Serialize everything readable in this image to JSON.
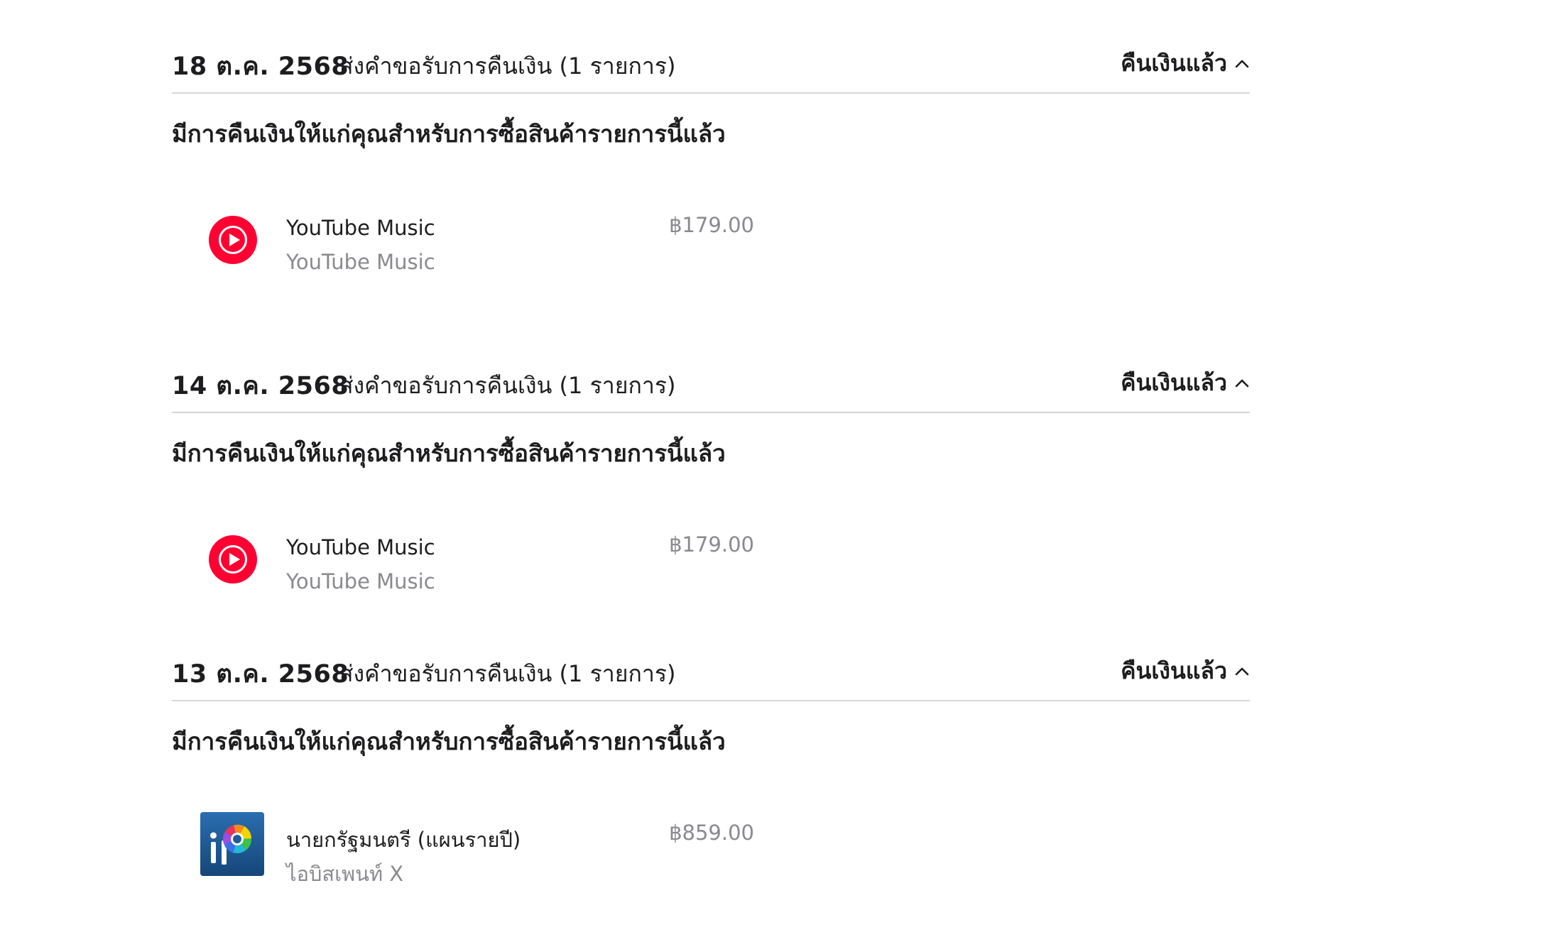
{
  "colors": {
    "accent_red": "#ff0033",
    "text_primary": "#1d1d1f",
    "text_secondary": "#8a8a8e",
    "divider": "#d6d6d6",
    "ibis_bg": "#1f5c99"
  },
  "sections": [
    {
      "date": "18 ต.ค. 2568",
      "type": "ส่งคำขอรับการคืนเงิน (1 รายการ)",
      "status": "คืนเงินแล้ว",
      "status_icon": "chevron-up-icon",
      "note": "มีการคืนเงินให้แก่คุณสำหรับการซื้อสินค้ารายการนี้แล้ว",
      "item": {
        "icon": "youtube-music-icon",
        "title": "YouTube Music",
        "subtitle": "YouTube Music",
        "price": "฿179.00"
      }
    },
    {
      "date": "14 ต.ค. 2568",
      "type": "ส่งคำขอรับการคืนเงิน (1 รายการ)",
      "status": "คืนเงินแล้ว",
      "status_icon": "chevron-up-icon",
      "note": "มีการคืนเงินให้แก่คุณสำหรับการซื้อสินค้ารายการนี้แล้ว",
      "item": {
        "icon": "youtube-music-icon",
        "title": "YouTube Music",
        "subtitle": "YouTube Music",
        "price": "฿179.00"
      }
    },
    {
      "date": "13 ต.ค. 2568",
      "type": "ส่งคำขอรับการคืนเงิน (1 รายการ)",
      "status": "คืนเงินแล้ว",
      "status_icon": "chevron-up-icon",
      "note": "มีการคืนเงินให้แก่คุณสำหรับการซื้อสินค้ารายการนี้แล้ว",
      "item": {
        "icon": "ibis-paint-x-icon",
        "title": "นายกรัฐมนตรี (แผนรายปี)",
        "subtitle": "ไอบิสเพนท์ X",
        "price": "฿859.00"
      }
    }
  ]
}
